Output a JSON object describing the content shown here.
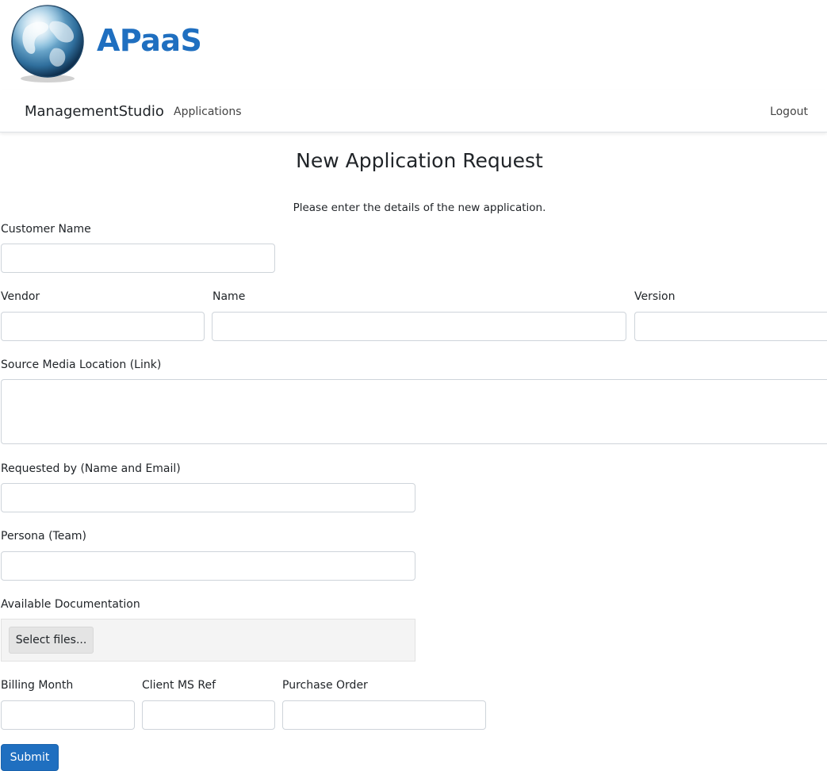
{
  "brand": {
    "name": "APaaS",
    "color": "#1f6fc0"
  },
  "navbar": {
    "brand": "ManagementStudio",
    "links": {
      "applications": "Applications",
      "logout": "Logout"
    }
  },
  "page": {
    "title": "New Application Request",
    "intro": "Please enter the details of the new application."
  },
  "form": {
    "customer_name": {
      "label": "Customer Name",
      "value": ""
    },
    "vendor": {
      "label": "Vendor",
      "value": ""
    },
    "name": {
      "label": "Name",
      "value": ""
    },
    "version": {
      "label": "Version",
      "value": ""
    },
    "source_media_location": {
      "label": "Source Media Location (Link)",
      "value": ""
    },
    "requested_by": {
      "label": "Requested by (Name and Email)",
      "value": ""
    },
    "persona": {
      "label": "Persona (Team)",
      "value": ""
    },
    "available_documentation": {
      "label": "Available Documentation",
      "button_label": "Select files..."
    },
    "billing_month": {
      "label": "Billing Month",
      "value": ""
    },
    "client_ms_ref": {
      "label": "Client MS Ref",
      "value": ""
    },
    "purchase_order": {
      "label": "Purchase Order",
      "value": ""
    },
    "submit_label": "Submit"
  },
  "colors": {
    "primary": "#1f6fc0",
    "border": "#ced4da",
    "text": "#212529"
  }
}
